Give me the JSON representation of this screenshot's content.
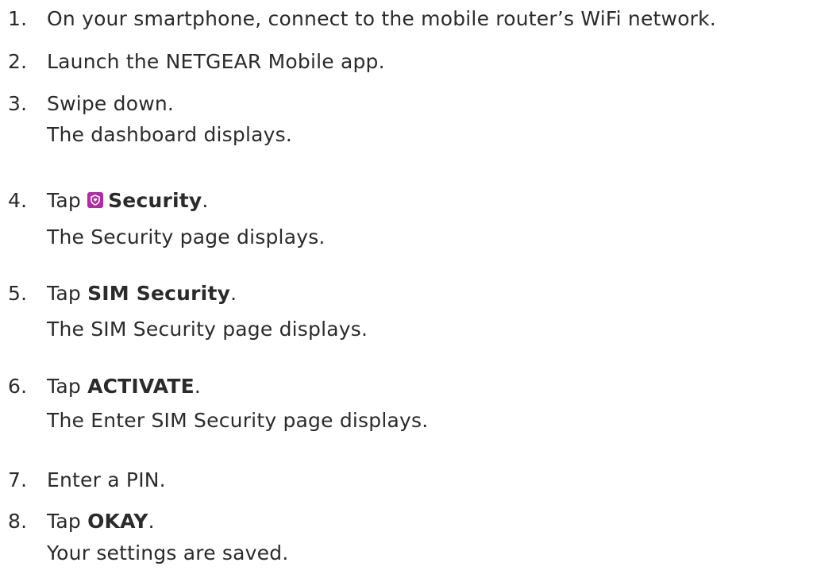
{
  "steps": [
    {
      "number": "1.",
      "pre": "On your smartphone, connect to the mobile router’s WiFi network.",
      "bold": "",
      "post": "",
      "result": ""
    },
    {
      "number": "2.",
      "pre": "Launch the NETGEAR Mobile app.",
      "bold": "",
      "post": "",
      "result": ""
    },
    {
      "number": "3.",
      "pre": "Swipe down.",
      "bold": "",
      "post": "",
      "result": "The dashboard displays."
    },
    {
      "number": "4.",
      "pre": "Tap ",
      "bold": "Security",
      "post": ".",
      "result": "The Security page displays.",
      "icon": "security-shield-icon"
    },
    {
      "number": "5.",
      "pre": "Tap ",
      "bold": "SIM Security",
      "post": ".",
      "result": "The SIM Security page displays."
    },
    {
      "number": "6.",
      "pre": "Tap ",
      "bold": "ACTIVATE",
      "post": ".",
      "result": "The Enter SIM Security page displays."
    },
    {
      "number": "7.",
      "pre": "Enter a PIN.",
      "bold": "",
      "post": "",
      "result": ""
    },
    {
      "number": "8.",
      "pre": "Tap ",
      "bold": "OKAY",
      "post": ".",
      "result": "Your settings are saved."
    }
  ],
  "colors": {
    "text": "#2b2b2b",
    "icon_bg": "#b32aa8"
  }
}
